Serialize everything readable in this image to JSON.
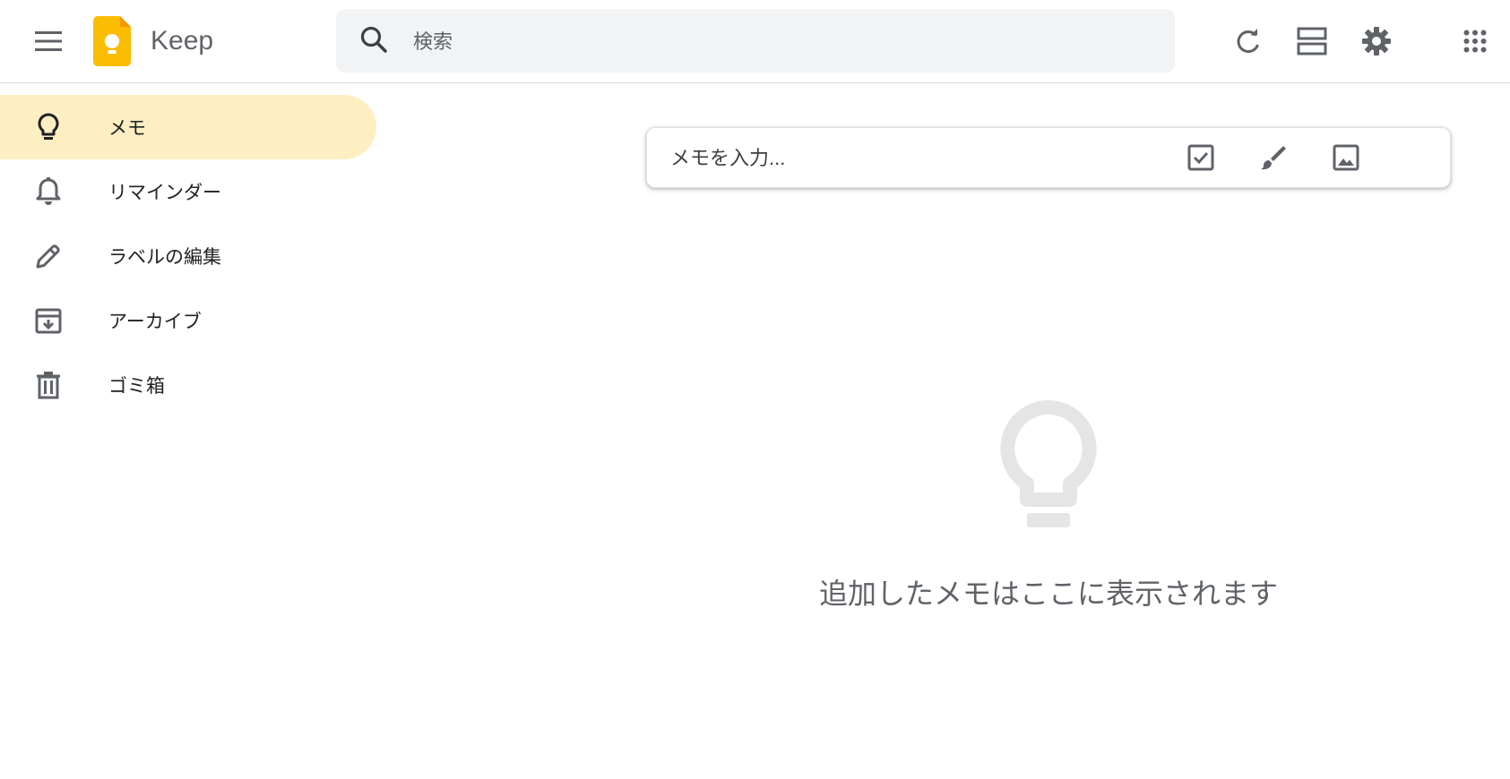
{
  "header": {
    "app_name": "Keep",
    "search_placeholder": "検索"
  },
  "sidebar": {
    "items": [
      {
        "label": "メモ",
        "icon": "lightbulb-icon",
        "active": true
      },
      {
        "label": "リマインダー",
        "icon": "bell-icon",
        "active": false
      },
      {
        "label": "ラベルの編集",
        "icon": "pencil-icon",
        "active": false
      },
      {
        "label": "アーカイブ",
        "icon": "archive-icon",
        "active": false
      },
      {
        "label": "ゴミ箱",
        "icon": "trash-icon",
        "active": false
      }
    ]
  },
  "composer": {
    "placeholder": "メモを入力..."
  },
  "empty_state": {
    "message": "追加したメモはここに表示されます"
  },
  "colors": {
    "active_nav": "#feefc3",
    "logo": "#fbbc04",
    "icon": "#5f6368"
  }
}
